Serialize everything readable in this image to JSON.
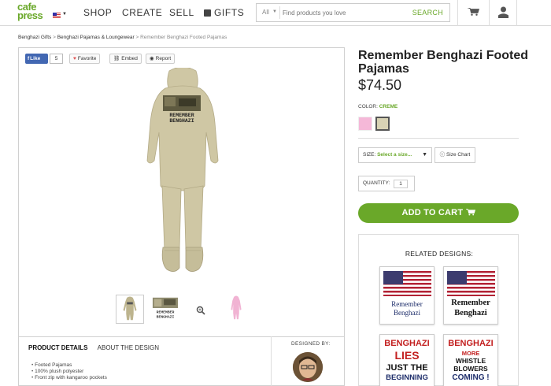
{
  "brand": {
    "line1": "cafe",
    "line2": "press",
    "accent": "#6aa829"
  },
  "nav": {
    "shop": "SHOP",
    "create": "CREATE",
    "sell": "SELL",
    "gifts": "GIFTS"
  },
  "search": {
    "scope": "All",
    "placeholder": "Find products you love",
    "button": "SEARCH"
  },
  "icons": {
    "cart": "shopping-cart-icon",
    "user": "user-icon",
    "flag": "us-flag-icon",
    "zoom": "magnifier-icon"
  },
  "breadcrumb": {
    "level1": "Benghazi Gifts",
    "level2": "Benghazi Pajamas & Loungewear",
    "current": "Remember Benghazi Footed Pajamas",
    "sep": ">"
  },
  "social": {
    "like_label": "Like",
    "like_count": "5",
    "favorite": "Favorite",
    "embed": "Embed",
    "report": "Report"
  },
  "product": {
    "title": "Remember Benghazi Footed Pajamas",
    "price": "$74.50",
    "print_text": "REMEMBER BENGHAZI",
    "color_label": "COLOR:",
    "color_value": "CREME",
    "swatches": [
      "pink",
      "creme"
    ],
    "size_label": "SIZE:",
    "size_value": "Select a size...",
    "size_chart": "Size Chart",
    "quantity_label": "QUANTITY:",
    "quantity_value": "1",
    "add_to_cart": "ADD TO CART"
  },
  "details": {
    "tab_product": "PRODUCT DETAILS",
    "tab_design": "ABOUT THE DESIGN",
    "features": [
      "Footed Pajamas",
      "100% plush polyester",
      "Front zip with kangaroo pockets"
    ],
    "designed_by": "DESIGNED BY:"
  },
  "related": {
    "title": "RELATED DESIGNS:",
    "cards": [
      {
        "line1": "Remember",
        "line2": "Benghazi"
      },
      {
        "line1": "Remember",
        "line2": "Benghazi"
      },
      {
        "line1": "BENGHAZI",
        "line2": "LIES",
        "line3": "JUST THE",
        "line4": "BEGINNING"
      },
      {
        "line1": "BENGHAZI",
        "line2": "MORE",
        "line3": "WHISTLE",
        "line4": "BLOWERS",
        "line5": "COMING !"
      }
    ]
  },
  "colors": {
    "pajama": "#cfc7a4",
    "pink": "#f5b8d8",
    "creme": "#d8d2b4",
    "accent": "#6aa829"
  }
}
